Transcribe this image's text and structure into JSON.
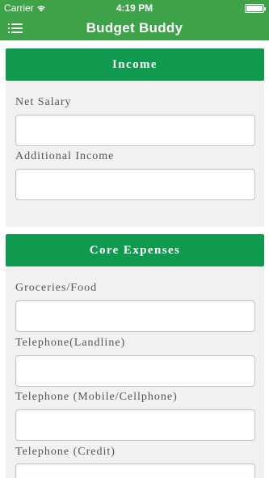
{
  "status_bar": {
    "carrier": "Carrier",
    "time": "4:19 PM"
  },
  "nav": {
    "title": "Budget Buddy",
    "menu_icon": "menu-icon"
  },
  "income": {
    "header": "Income",
    "fields": [
      {
        "label": "Net Salary",
        "value": ""
      },
      {
        "label": "Additional Income",
        "value": ""
      }
    ]
  },
  "core_expenses": {
    "header": "Core Expenses",
    "fields": [
      {
        "label": "Groceries/Food",
        "value": ""
      },
      {
        "label": "Telephone(Landline)",
        "value": ""
      },
      {
        "label": "Telephone (Mobile/Cellphone)",
        "value": ""
      },
      {
        "label": "Telephone (Credit)",
        "value": ""
      }
    ]
  }
}
